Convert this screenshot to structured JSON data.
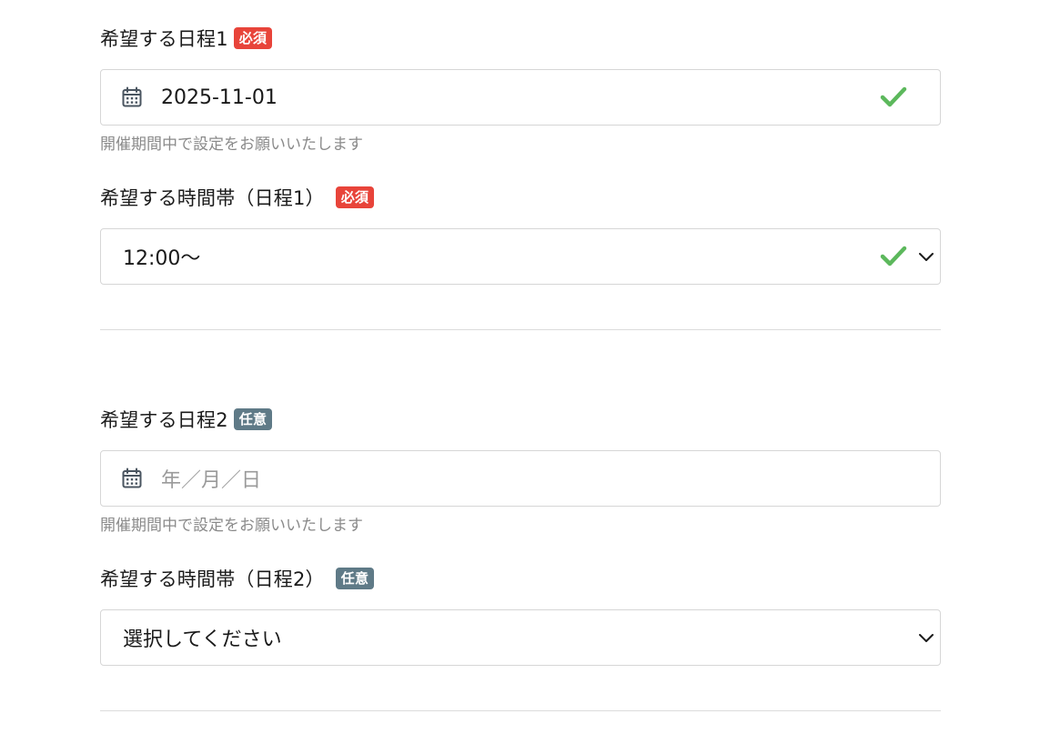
{
  "schedule1": {
    "date_label": "希望する日程1",
    "date_badge": "必須",
    "date_value": "2025-11-01",
    "date_hint": "開催期間中で設定をお願いいたします",
    "time_label": "希望する時間帯（日程1）",
    "time_badge": "必須",
    "time_value": "12:00〜"
  },
  "schedule2": {
    "date_label": "希望する日程2",
    "date_badge": "任意",
    "date_placeholder": "年／月／日",
    "date_hint": "開催期間中で設定をお願いいたします",
    "time_label": "希望する時間帯（日程2）",
    "time_badge": "任意",
    "time_value": "選択してください"
  },
  "colors": {
    "required_badge": "#e8443a",
    "optional_badge": "#5f7a87",
    "valid_check": "#5cb85c",
    "hint_text": "#8a8a8a",
    "border": "#d6d6d6"
  },
  "icons": {
    "date_field": "calendar-icon",
    "valid": "check-icon",
    "select": "chevron-down-icon"
  }
}
